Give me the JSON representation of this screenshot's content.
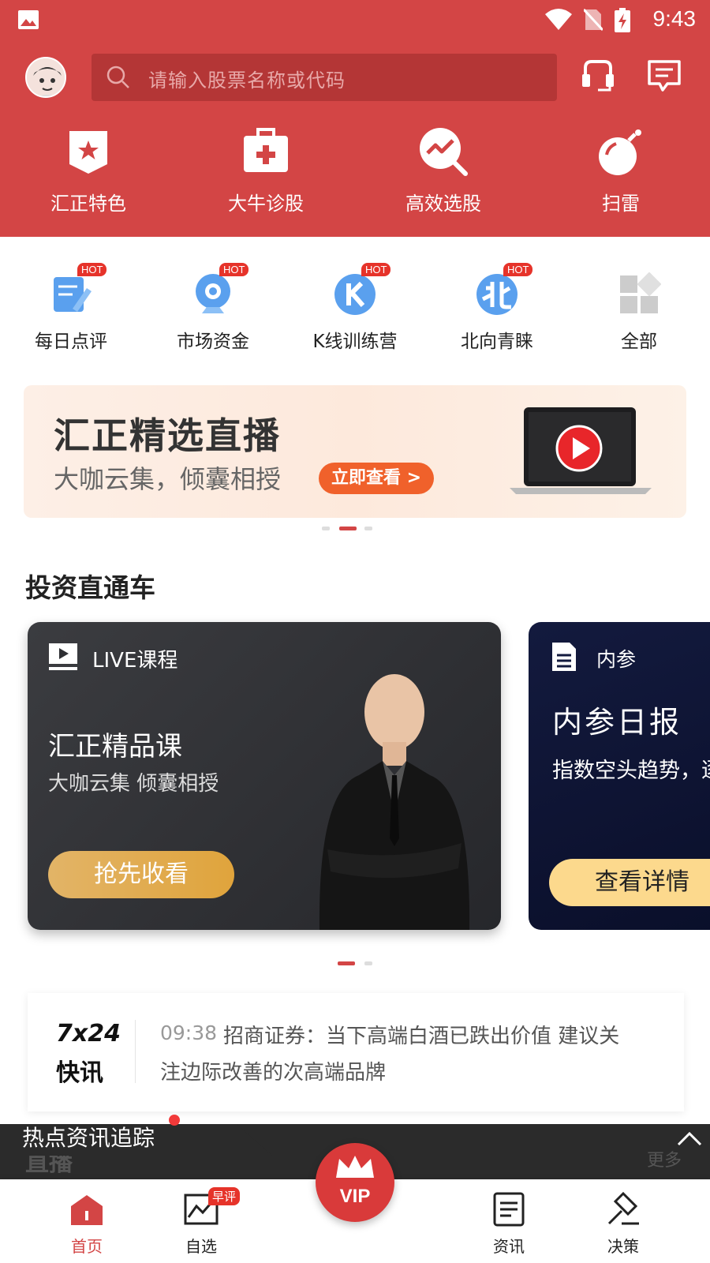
{
  "status": {
    "time": "9:43"
  },
  "header": {
    "search_placeholder": "请输入股票名称或代码"
  },
  "quick_links": [
    {
      "label": "汇正特色"
    },
    {
      "label": "大牛诊股"
    },
    {
      "label": "高效选股"
    },
    {
      "label": "扫雷"
    }
  ],
  "shortcuts": [
    {
      "label": "每日点评",
      "badge": "HOT"
    },
    {
      "label": "市场资金",
      "badge": "HOT"
    },
    {
      "label": "K线训练营",
      "badge": "HOT"
    },
    {
      "label": "北向青睐",
      "badge": "HOT"
    },
    {
      "label": "全部"
    }
  ],
  "banner": {
    "title": "汇正精选直播",
    "subtitle": "大咖云集，倾囊相授",
    "cta": "立即查看 >"
  },
  "section": {
    "title": "投资直通车"
  },
  "cards": [
    {
      "tag": "LIVE课程",
      "title": "汇正精品课",
      "subtitle": "大咖云集 倾囊相授",
      "cta": "抢先收看"
    },
    {
      "tag": "内参",
      "title": "内参日报",
      "subtitle": "指数空头趋势，逐",
      "cta": "查看详情"
    }
  ],
  "news": {
    "logo_top": "7x24",
    "logo_bottom": "快讯",
    "time": "09:38",
    "text_line1": "招商证券：当下高端白酒已跌出价值 建议关",
    "text_line2": "注边际改善的次高端品牌"
  },
  "hot_tracking": {
    "label": "热点资讯追踪",
    "behind_text": "直播",
    "more": "更多"
  },
  "bottom_nav": [
    {
      "label": "首页"
    },
    {
      "label": "自选",
      "badge": "早评"
    },
    {
      "label": "VIP"
    },
    {
      "label": "资讯"
    },
    {
      "label": "决策"
    }
  ],
  "colors": {
    "brand_red": "#d34545",
    "gold": "#e0a43c",
    "dark_card": "#2e2f33"
  }
}
